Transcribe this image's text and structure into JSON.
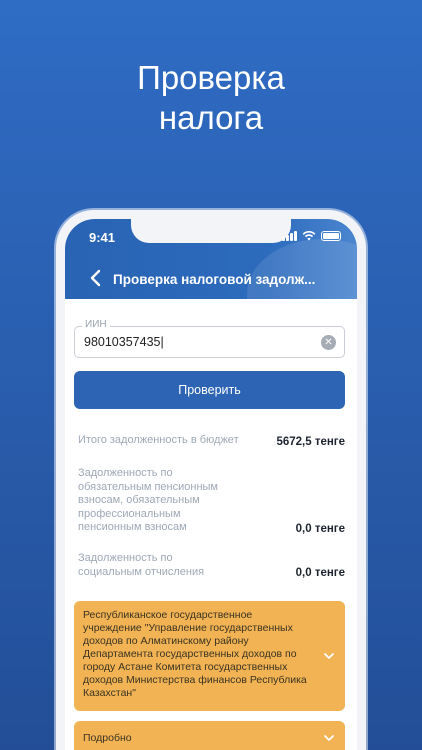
{
  "headline": {
    "line1": "Проверка",
    "line2": "налога"
  },
  "status": {
    "time": "9:41"
  },
  "nav": {
    "title": "Проверка налоговой задолж..."
  },
  "form": {
    "iin_label": "ИИН",
    "iin_value": "98010357435|",
    "check_button": "Проверить"
  },
  "results": [
    {
      "label": "Итого задолженность в бюджет",
      "value": "5672,5 тенге"
    },
    {
      "label": "Задолженность по обязательным пенсионным взносам, обязательным профессиональным пенсионным взносам",
      "value": "0,0 тенге"
    },
    {
      "label": "Задолженность по социальным отчисления",
      "value": "0,0 тенге"
    }
  ],
  "authority": {
    "text": "Республиканское государственное учреждение \"Управление государственных доходов по Алматинскому району Департамента государственных доходов по городу Астане Комитета государственных доходов Министерства финансов Республика Казахстан\""
  },
  "details": {
    "label": "Подробно"
  },
  "colors": {
    "primary": "#2d64b3",
    "accent": "#f1b354"
  }
}
